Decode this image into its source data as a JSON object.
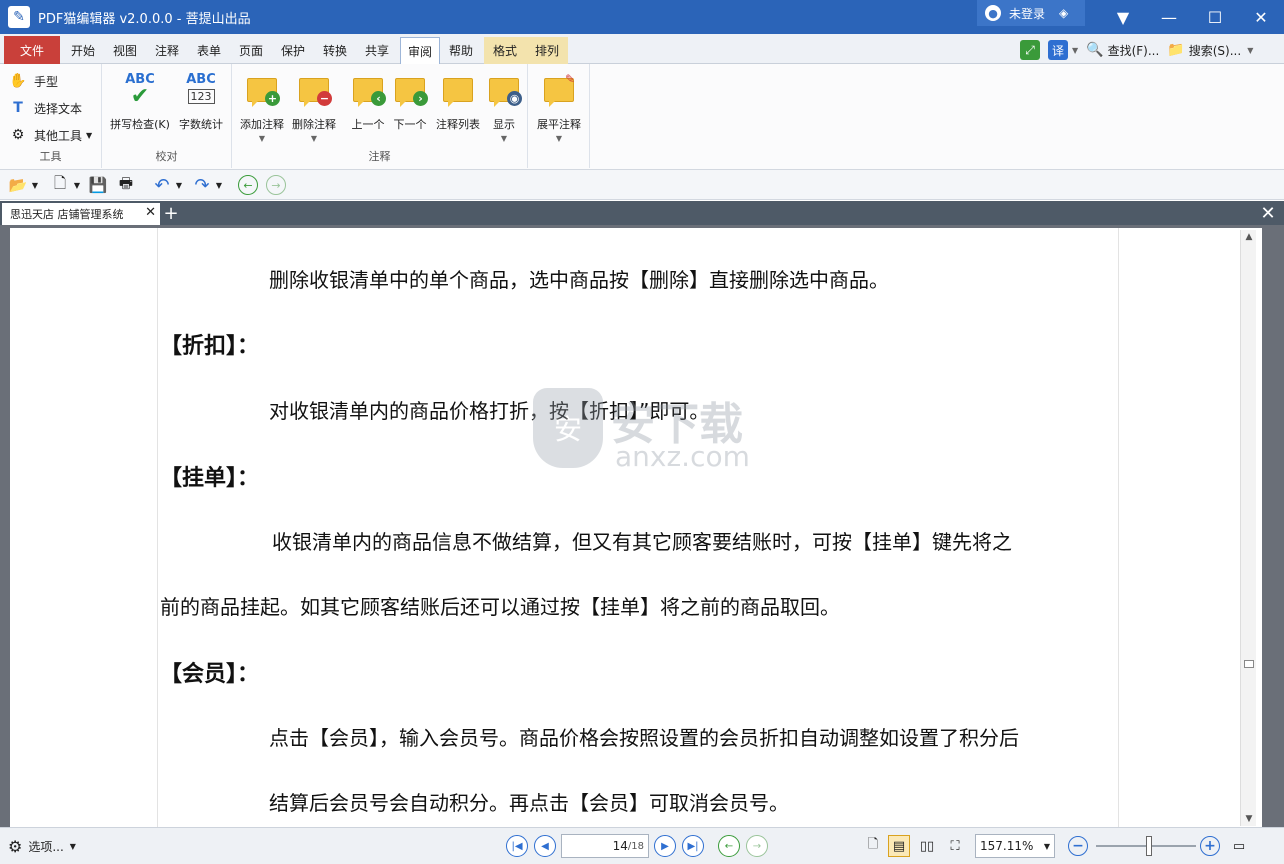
{
  "window": {
    "title": "PDF猫编辑器 v2.0.0.0 - 菩提山出品",
    "login": "未登录",
    "controls": {
      "menu": "▼",
      "minimize": "—",
      "maximize": "☐",
      "close": "✕"
    }
  },
  "tabs": [
    "文件",
    "开始",
    "视图",
    "注释",
    "表单",
    "页面",
    "保护",
    "转换",
    "共享",
    "审阅",
    "帮助",
    "格式",
    "排列"
  ],
  "active_tab": "审阅",
  "right_tools": {
    "translate": "译",
    "find": "查找(F)...",
    "search": "搜索(S)..."
  },
  "ribbon": {
    "tools_group": {
      "label": "工具",
      "hand": "手型",
      "select_text": "选择文本",
      "other_tools": "其他工具"
    },
    "proof_group": {
      "label": "校对",
      "spell_check": "拼写检查(K)",
      "word_count": "字数统计",
      "abc": "ABC",
      "num": "123"
    },
    "annot_group": {
      "label": "注释",
      "add": "添加注释",
      "delete": "删除注释",
      "prev": "上一个",
      "next": "下一个",
      "list": "注释列表",
      "show": "显示"
    },
    "flatten": "展平注释"
  },
  "doc_tab": {
    "title": "思迅天店 店铺管理系统",
    "close": "✕"
  },
  "document": {
    "line1": "删除收银清单中的单个商品，选中商品按【删除】直接删除选中商品。",
    "h_discount": "【折扣】：",
    "line2": "对收银清单内的商品价格打折，按【折扣】”即可。",
    "h_hold": "【挂单】：",
    "line3": "收银清单内的商品信息不做结算，但又有其它顾客要结账时，可按【挂单】键先将之",
    "line4": "前的商品挂起。如其它顾客结账后还可以通过按【挂单】将之前的商品取回。",
    "h_member": "【会员】：",
    "line5": "点击【会员】，输入会员号。商品价格会按照设置的会员折扣自动调整如设置了积分后",
    "line6": "结算后会员号会自动积分。再点击【会员】可取消会员号。"
  },
  "watermark": {
    "cn": "安下载",
    "url": "anxz.com",
    "shield": "安"
  },
  "status": {
    "options": "选项...",
    "page_current": "14",
    "page_total": "/18",
    "zoom": "157.11%"
  },
  "colors": {
    "title_bar": "#2b64b8",
    "file_tab": "#c9403a",
    "group_tab": "#f3e3ad",
    "note": "#f5c542"
  }
}
